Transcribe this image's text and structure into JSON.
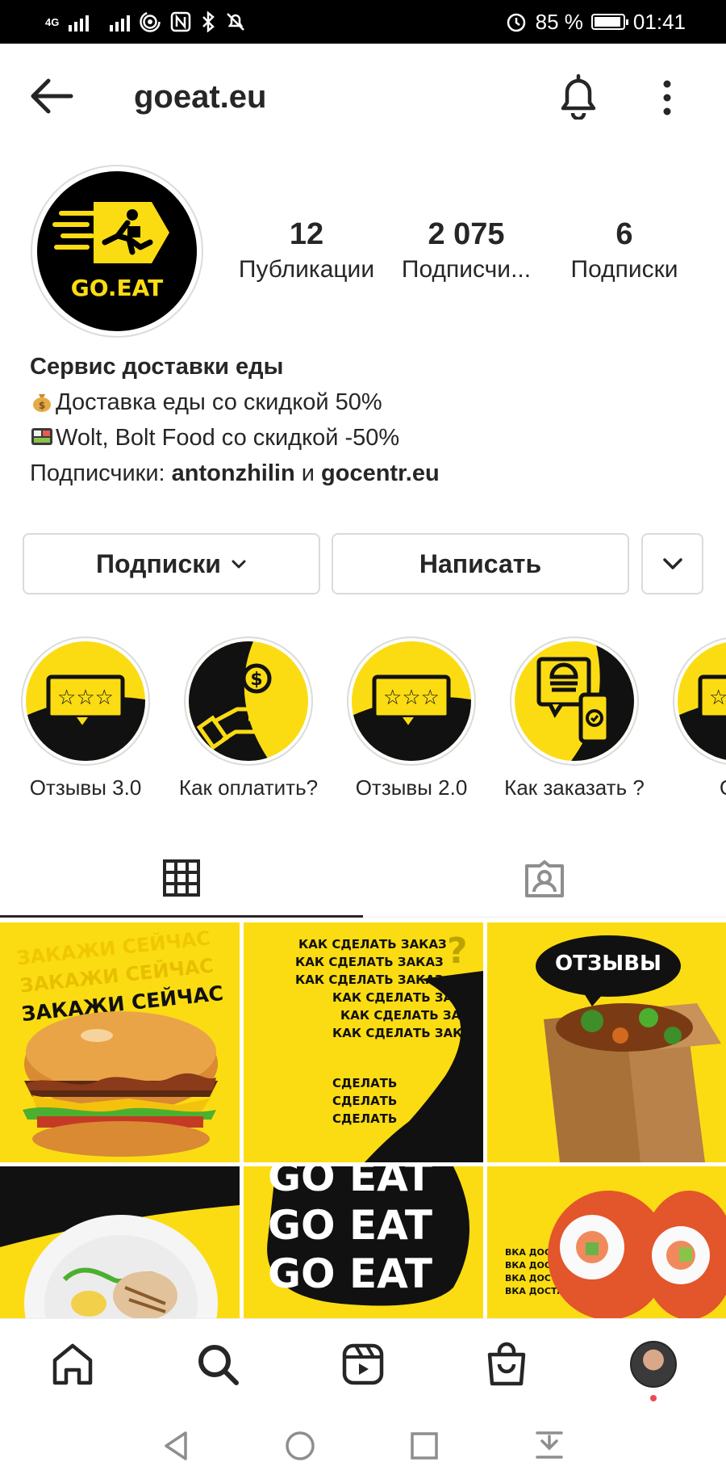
{
  "status_bar": {
    "network": "4G",
    "battery_percent": "85 %",
    "time": "01:41",
    "icons": [
      "signal-icon",
      "signal-2-icon",
      "hotspot-icon",
      "nfc-icon",
      "bluetooth-icon",
      "mute-icon",
      "alarm-icon",
      "battery-icon"
    ]
  },
  "header": {
    "username": "goeat.eu",
    "icons": [
      "back-arrow-icon",
      "bell-icon",
      "more-vertical-icon"
    ]
  },
  "profile": {
    "avatar_text": "GO.EAT",
    "stats": [
      {
        "value": "12",
        "label": "Публикации"
      },
      {
        "value": "2 075",
        "label": "Подписчи..."
      },
      {
        "value": "6",
        "label": "Подписки"
      }
    ],
    "bio": {
      "name": "Сервис доставки еды",
      "line1": "Доставка еды со скидкой 50%",
      "line2": "Wolt, Bolt Food  со скидкой -50%",
      "followers_prefix": "Подписчики: ",
      "follower1": "antonzhilin",
      "and": " и ",
      "follower2": "gocentr.eu"
    }
  },
  "actions": {
    "follow_label": "Подписки",
    "message_label": "Написать"
  },
  "highlights": [
    {
      "label": "Отзывы 3.0"
    },
    {
      "label": "Как оплатить?"
    },
    {
      "label": "Отзывы 2.0"
    },
    {
      "label": "Как заказать ?"
    },
    {
      "label": "Отз"
    }
  ],
  "tabs": [
    "grid-icon",
    "tagged-icon"
  ],
  "posts": {
    "p1_text": "ЗАКАЖИ СЕЙЧАС",
    "p2_text": "КАК СДЕЛАТЬ ЗАКАЗ",
    "p2_short": "СДЕЛАТЬ",
    "p3_text": "ОТЗЫВЫ",
    "p5_text": "GO EAT",
    "p6_text": "ВКА ДОСТАВКА ДО"
  },
  "colors": {
    "brand_yellow": "#fbdc13",
    "text": "#262626",
    "border": "#dbdbdb",
    "notification": "#ed4956"
  }
}
